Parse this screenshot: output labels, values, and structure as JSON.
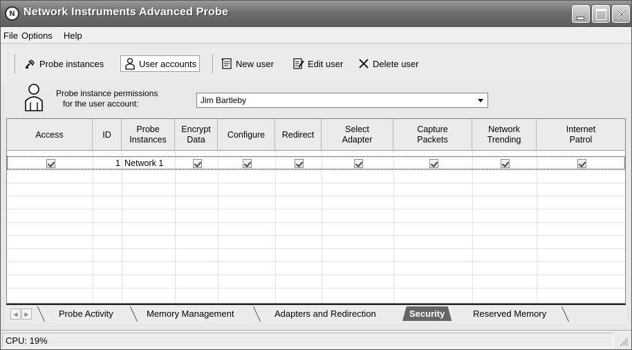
{
  "window": {
    "title": "Network Instruments Advanced Probe",
    "icon_glyph": "N"
  },
  "menu": [
    "File",
    "Options",
    "Help"
  ],
  "toolbar": {
    "probe_instances": "Probe instances",
    "user_accounts": "User accounts",
    "new_user": "New user",
    "edit_user": "Edit user",
    "delete_user": "Delete user"
  },
  "permissions": {
    "label_line1": "Probe instance permissions",
    "label_line2": "for the user account:",
    "selected_user": "Jim Bartleby"
  },
  "grid": {
    "columns": [
      {
        "line1": "Access",
        "line2": ""
      },
      {
        "line1": "ID",
        "line2": ""
      },
      {
        "line1": "Probe",
        "line2": "Instances"
      },
      {
        "line1": "Encrypt",
        "line2": "Data"
      },
      {
        "line1": "Configure",
        "line2": ""
      },
      {
        "line1": "Redirect",
        "line2": ""
      },
      {
        "line1": "Select",
        "line2": "Adapter"
      },
      {
        "line1": "Capture",
        "line2": "Packets"
      },
      {
        "line1": "Network",
        "line2": "Trending"
      },
      {
        "line1": "Internet",
        "line2": "Patrol"
      }
    ],
    "rows": [
      {
        "access": true,
        "id": "1",
        "instance": "Network 1",
        "encrypt_data": true,
        "configure": true,
        "redirect": true,
        "select_adapter": true,
        "capture_packets": true,
        "network_trending": true,
        "internet_patrol": true
      }
    ]
  },
  "tabs": {
    "items": [
      "Probe Activity",
      "Memory Management",
      "Adapters and Redirection",
      "Security",
      "Reserved Memory"
    ],
    "active": "Security"
  },
  "status": {
    "cpu": "CPU: 19%"
  }
}
